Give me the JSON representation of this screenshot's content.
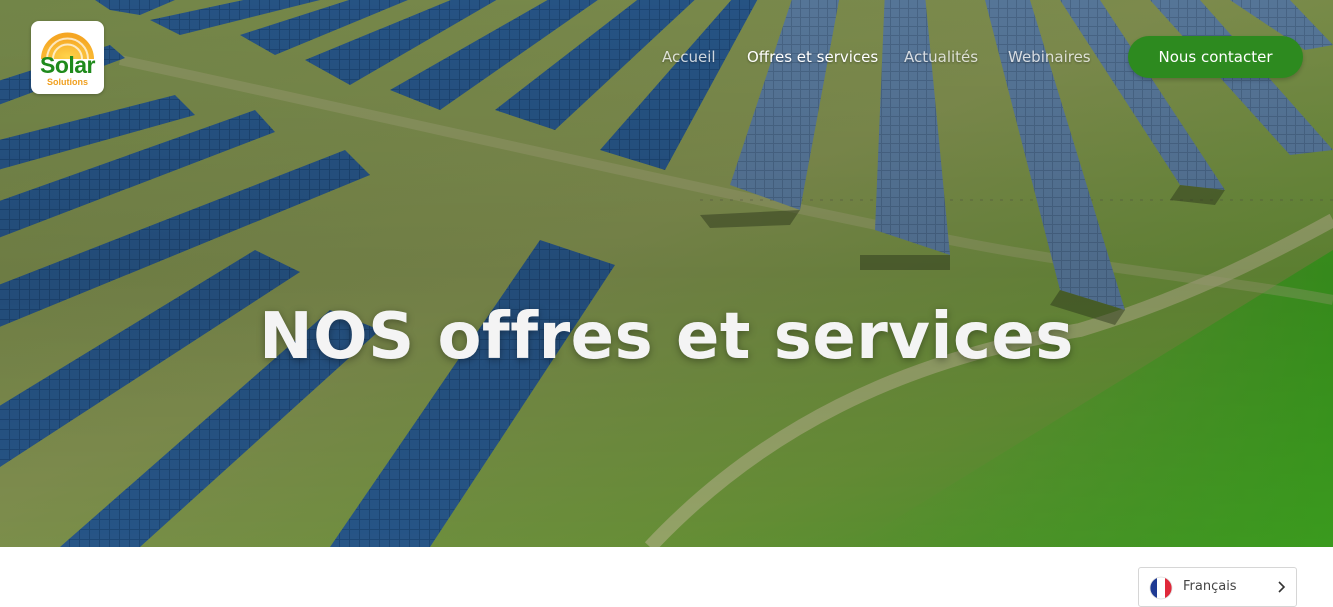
{
  "logo": {
    "word": "Solar",
    "sub": "Solutions",
    "colors": {
      "word": "#1f8a1c",
      "sun": "#f5a623",
      "sub": "#f0a020"
    }
  },
  "nav": {
    "items": [
      {
        "label": "Accueil",
        "active": false
      },
      {
        "label": "Offres et services",
        "active": true
      },
      {
        "label": "Actualités",
        "active": false
      },
      {
        "label": "Webinaires",
        "active": false
      }
    ]
  },
  "cta": {
    "label": "Nous contacter",
    "color": "#2d8a1f"
  },
  "hero": {
    "title": "NOS offres et services"
  },
  "language": {
    "label": "Français",
    "flag_icon": "france-flag-icon",
    "chevron_icon": "chevron-right-icon"
  }
}
